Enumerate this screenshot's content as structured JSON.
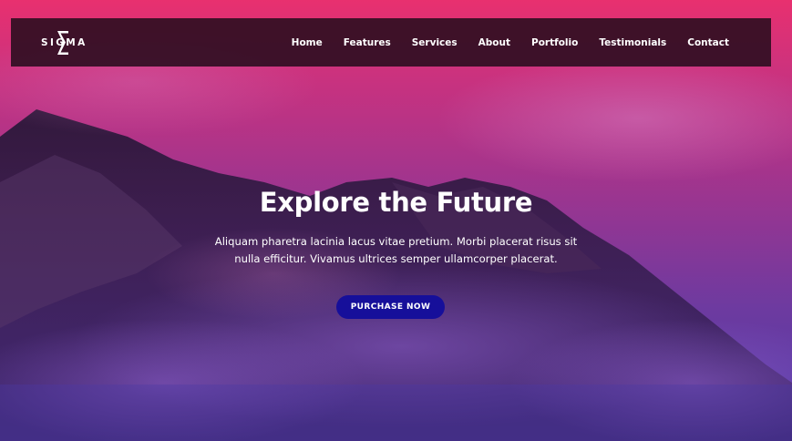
{
  "brand": {
    "name": "SIGMA",
    "logo_icon": "sigma-icon"
  },
  "nav": {
    "links": [
      {
        "label": "Home"
      },
      {
        "label": "Features"
      },
      {
        "label": "Services"
      },
      {
        "label": "About"
      },
      {
        "label": "Portfolio"
      },
      {
        "label": "Testimonials"
      },
      {
        "label": "Contact"
      }
    ]
  },
  "hero": {
    "title": "Explore the Future",
    "text": "Aliquam pharetra lacinia lacus vitae pretium. Morbi placerat risus sit nulla efficitur. Vivamus ultrices semper ullamcorper placerat.",
    "cta_label": "PURCHASE NOW"
  },
  "colors": {
    "navbar_bg": "#280c1e",
    "cta_bg": "#160f9a",
    "gradient_top": "#e8306f",
    "gradient_bottom": "#4b3aa6"
  }
}
